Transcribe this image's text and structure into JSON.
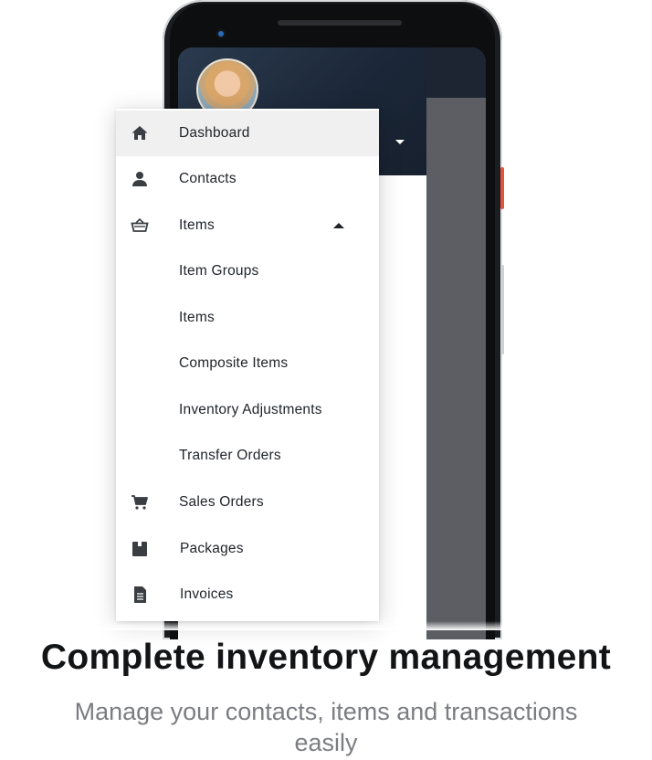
{
  "menu": {
    "items": [
      {
        "label": "Dashboard",
        "icon": "home-icon",
        "active": true
      },
      {
        "label": "Contacts",
        "icon": "person-icon"
      },
      {
        "label": "Items",
        "icon": "basket-icon",
        "expanded": true
      },
      {
        "label": "Item Groups"
      },
      {
        "label": "Items"
      },
      {
        "label": "Composite Items"
      },
      {
        "label": "Inventory Adjustments"
      },
      {
        "label": "Transfer Orders"
      },
      {
        "label": "Sales Orders",
        "icon": "cart-icon"
      },
      {
        "label": "Packages",
        "icon": "package-icon"
      },
      {
        "label": "Invoices",
        "icon": "invoice-icon"
      }
    ]
  },
  "hero": {
    "headline": "Complete inventory management",
    "subline": "Manage your contacts, items and transactions easily"
  },
  "colors": {
    "header_bg": "#1b2738",
    "accent_red": "#e2533d",
    "active_row": "#f0f0f0"
  }
}
